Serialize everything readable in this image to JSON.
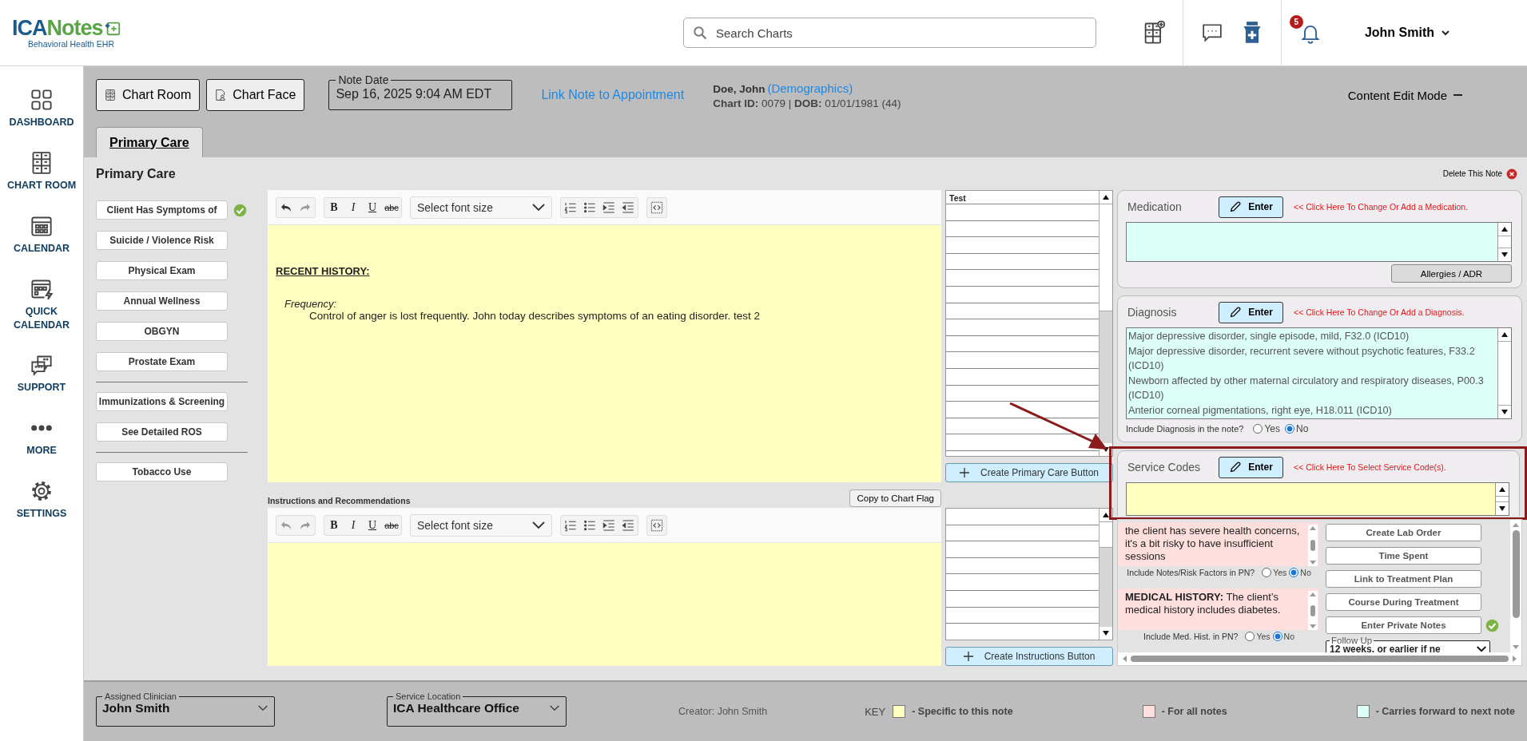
{
  "header": {
    "logo": {
      "prefix": "ICA",
      "name": "Notes",
      "tagline": "Behavioral Health EHR"
    },
    "search": {
      "placeholder": "Search Charts"
    },
    "notifications": {
      "count": "5"
    },
    "user": {
      "name": "John Smith"
    }
  },
  "nav": [
    {
      "kind": "dashboard",
      "label": "DASHBOARD"
    },
    {
      "kind": "chart_room",
      "label": "CHART ROOM"
    },
    {
      "kind": "calendar",
      "label": "CALENDAR"
    },
    {
      "kind": "quick_calendar",
      "label": "QUICK CALENDAR"
    },
    {
      "kind": "support",
      "label": "SUPPORT"
    },
    {
      "kind": "more",
      "label": "MORE"
    },
    {
      "kind": "settings",
      "label": "SETTINGS"
    }
  ],
  "toolbar": {
    "buttons": [
      {
        "kind": "chart_room",
        "label": "Chart Room"
      },
      {
        "kind": "chart_face",
        "label": "Chart Face"
      }
    ],
    "note_date": {
      "label": "Note Date",
      "value": "Sep 16, 2025 9:04 AM EDT"
    },
    "link": "Link Note to Appointment",
    "patient": {
      "name": "Doe, John",
      "demographics_link": "(Demographics)",
      "details": "**Chart ID:** 0079 | **DOB:** 01/01/1981 (44)"
    },
    "mode": "Content Edit Mode"
  },
  "tabs": [
    {
      "label": "Primary Care",
      "selected": true
    }
  ],
  "section": {
    "title": "Primary Care",
    "delete_label": "Delete This Note"
  },
  "template_buttons": [
    {
      "label": "Client Has Symptoms of",
      "done": true,
      "separated": false
    },
    {
      "label": "Suicide / Violence Risk",
      "done": false,
      "separated": false
    },
    {
      "label": "Physical Exam",
      "done": false,
      "separated": false
    },
    {
      "label": "Annual Wellness",
      "done": false,
      "separated": false
    },
    {
      "label": "OBGYN",
      "done": false,
      "separated": false
    },
    {
      "label": "Prostate Exam",
      "done": false,
      "separated": false
    },
    {
      "label": "Immunizations & Screening",
      "done": false,
      "separated": true
    },
    {
      "label": "See Detailed ROS",
      "done": false,
      "separated": false
    },
    {
      "label": "Tobacco Use",
      "done": false,
      "separated": true
    }
  ],
  "editors": [
    {
      "undo_enabled": true,
      "format_buttons": [
        {
          "kind": "bold",
          "label": "B"
        },
        {
          "kind": "italic",
          "label": "I"
        },
        {
          "kind": "underline",
          "label": "U"
        },
        {
          "kind": "strike",
          "label": "abc"
        }
      ],
      "font_size_placeholder": "Select font size",
      "content": [
        {
          "kind": "heading",
          "text": "RECENT HISTORY:"
        },
        {
          "kind": "subheading",
          "text": "Frequency:"
        },
        {
          "kind": "body",
          "text": "Control of anger is lost frequently. John today describes symptoms of an eating disorder. test 2"
        }
      ],
      "side_list": {
        "header": "Test"
      },
      "create_button": "Create Primary Care Button"
    },
    {
      "title": "Instructions and Recommendations",
      "copy_button": "Copy to Chart Flag",
      "undo_enabled": false,
      "format_buttons": [
        {
          "kind": "bold",
          "label": "B"
        },
        {
          "kind": "italic",
          "label": "I"
        },
        {
          "kind": "underline",
          "label": "U"
        },
        {
          "kind": "strike",
          "label": "abc"
        }
      ],
      "font_size_placeholder": "Select font size",
      "create_button": "Create Instructions Button"
    }
  ],
  "medication": {
    "title": "Medication",
    "enter_label": "Enter",
    "hint": "<< Click Here To Change Or Add a Medication.",
    "allergies_button": "Allergies / ADR"
  },
  "diagnosis": {
    "title": "Diagnosis",
    "enter_label": "Enter",
    "hint": "<< Click Here To Change Or Add a Diagnosis.",
    "items": [
      "Major depressive disorder, single episode, mild, F32.0 (ICD10)",
      "Major depressive disorder, recurrent severe without psychotic features, F33.2 (ICD10)",
      "Newborn affected by other maternal circulatory and respiratory diseases, P00.3 (ICD10)",
      "Anterior corneal pigmentations, right eye, H18.011 (ICD10)"
    ],
    "include": {
      "question": "Include Diagnosis in the note?",
      "options": [
        {
          "label": "Yes",
          "selected": false
        },
        {
          "label": "No",
          "selected": true
        }
      ]
    }
  },
  "service_codes": {
    "title": "Service Codes",
    "enter_label": "Enter",
    "hint": "<< Click Here To Select Service Code(s).",
    "highlighted": true
  },
  "notes": [
    {
      "text": "the client has severe health concerns, it's a bit risky to have insufficient sessions",
      "question": "Include Notes/Risk Factors in PN?",
      "options": [
        {
          "label": "Yes",
          "selected": false
        },
        {
          "label": "No",
          "selected": true
        }
      ]
    },
    {
      "text": "**MEDICAL HISTORY:** The client’s medical history includes diabetes.",
      "question": "Include Med. Hist. in PN?",
      "options": [
        {
          "label": "Yes",
          "selected": false
        },
        {
          "label": "No",
          "selected": true
        }
      ]
    }
  ],
  "actions": [
    {
      "label": "Create Lab Order",
      "done": false
    },
    {
      "label": "Time Spent",
      "done": false
    },
    {
      "label": "Link to Treatment Plan",
      "done": false
    },
    {
      "label": "Course During Treatment",
      "done": false
    },
    {
      "label": "Enter Private Notes",
      "done": true
    }
  ],
  "follow_up": {
    "label": "Follow Up",
    "value": "12 weeks, or earlier if ne"
  },
  "footer": {
    "clinician": {
      "label": "Assigned Clinician",
      "value": "John Smith"
    },
    "location": {
      "label": "Service Location",
      "value": "ICA Healthcare Office"
    },
    "creator": "Creator: John Smith",
    "key_label": "KEY",
    "key": [
      {
        "color": "#ffffc0",
        "label": "- Specific to this note"
      },
      {
        "color": "#ffdede",
        "label": "- For all notes"
      },
      {
        "color": "#dcfff8",
        "label": "- Carries forward to next note"
      }
    ]
  }
}
